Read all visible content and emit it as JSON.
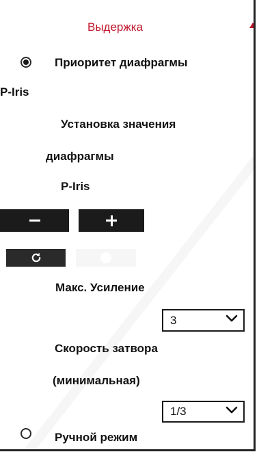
{
  "exposure": {
    "section_title": "Выдержка",
    "aperture_priority_label": "Приоритет диафрагмы",
    "iris_mode_label": "P-Iris",
    "aperture_setting_label_line1": "Установка значения",
    "aperture_setting_label_line2": "диафрагмы",
    "iris_control_label": "P-Iris",
    "max_gain_label": "Макс. Усиление",
    "max_gain_value": "3",
    "shutter_label_line1": "Скорость затвора",
    "shutter_label_line2": "(минимальная)",
    "shutter_value": "1/3",
    "manual_mode_label": "Ручной режим"
  },
  "icons": {
    "collapse": "triangle-up-icon",
    "minus": "minus-icon",
    "plus": "plus-icon",
    "reset": "refresh-icon",
    "dropdown": "chevron-down-icon"
  },
  "colors": {
    "section_title": "#c0172b",
    "button_bg": "#1b1b1b"
  }
}
